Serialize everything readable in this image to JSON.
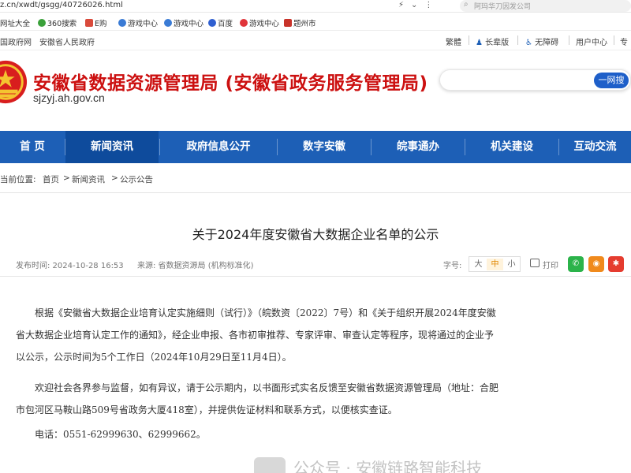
{
  "browser": {
    "url": "z.cn/xwdt/gsgg/40726026.html",
    "search_placeholder": "阿玛华刀因发公司",
    "bookmarks": [
      "网址大全",
      "360搜索",
      "E购",
      "游戏中心",
      "游戏中心",
      "百度",
      "游戏中心",
      "题州市"
    ]
  },
  "govstrip": {
    "left_links": [
      "国政府网",
      "安徽省人民政府"
    ],
    "right_links": [
      "繁體",
      "长辈版",
      "无障碍",
      "用户中心",
      "专"
    ]
  },
  "header": {
    "title": "安徽省数据资源管理局 (安徽省政务服务管理局)",
    "domain": "sjzyj.ah.gov.cn",
    "search_button": "一网搜"
  },
  "nav": {
    "items": [
      "首 页",
      "新闻资讯",
      "政府信息公开",
      "数字安徽",
      "皖事通办",
      "机关建设",
      "互动交流"
    ],
    "active_index": 1
  },
  "breadcrumb": {
    "label": "当前位置:",
    "items": [
      "首页",
      ">",
      "新闻资讯",
      ">",
      "公示公告"
    ]
  },
  "article": {
    "title": "关于2024年度安徽省大数据企业名单的公示",
    "publish_time": "发布时间: 2024-10-28 16:53",
    "source": "来源: 省数据资源局 (机构标准化)",
    "font_size_label": "字号:",
    "font_sizes": [
      "大",
      "中",
      "小"
    ],
    "font_size_active": 1,
    "print_label": "打印",
    "lines": [
      "根据《安徽省大数据企业培育认定实施细则（试行）》（皖数资〔2022〕7号）和《关于组织开展2024年度安徽",
      "省大数据企业培育认定工作的通知》，经企业申报、各市初审推荐、专家评审、审查认定等程序，现将通过的企业予",
      "以公示，公示时间为5个工作日（2024年10月29日至11月4日）。",
      "欢迎社会各界参与监督，如有异议，请于公示期内，以书面形式实名反馈至安徽省数据资源管理局（地址：合肥",
      "市包河区马鞍山路509号省政务大厦418室），并提供佐证材料和联系方式，以便核实查证。",
      "电话：0551-62999630、62999662。"
    ]
  },
  "watermark": "公众号 · 安徽链路智能科技",
  "colors": {
    "nav_bg": "#1d5fb6",
    "nav_active": "#0e4b9c",
    "title_red": "#cc1010",
    "search_btn": "#1e5fc9"
  }
}
